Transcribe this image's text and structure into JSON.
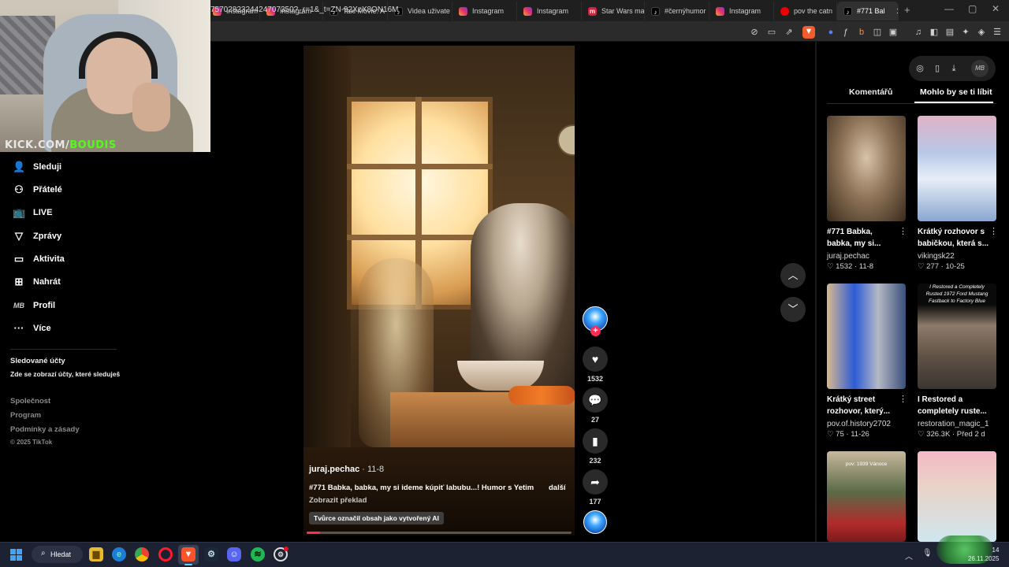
{
  "browser": {
    "tabs": [
      {
        "label": "Instagram",
        "favicon": "instagram"
      },
      {
        "label": "Instagram",
        "favicon": "instagram"
      },
      {
        "label": "Taxi Movie: A",
        "favicon": "tiktok"
      },
      {
        "label": "Videa uživate",
        "favicon": "tiktok"
      },
      {
        "label": "Instagram",
        "favicon": "instagram"
      },
      {
        "label": "Instagram",
        "favicon": "instagram"
      },
      {
        "label": "Star Wars ma",
        "favicon": "m"
      },
      {
        "label": "#černýhumor",
        "favicon": "tiktok"
      },
      {
        "label": "Instagram",
        "favicon": "instagram"
      },
      {
        "label": "pov the catn",
        "favicon": "youtube"
      },
      {
        "label": "#771 Bal",
        "favicon": "tiktok",
        "active": true
      }
    ],
    "new_tab": "+",
    "url": "7570282324424707350?_r=1&_t=ZN-92XzX8ON16M"
  },
  "stream": {
    "logo_prefix": "KICK.COM/",
    "logo_name": "BOUDIS"
  },
  "sidebar": {
    "items": [
      {
        "label": "Sleduji",
        "icon": "following-icon"
      },
      {
        "label": "Přátelé",
        "icon": "friends-icon"
      },
      {
        "label": "LIVE",
        "icon": "live-icon"
      },
      {
        "label": "Zprávy",
        "icon": "messages-icon"
      },
      {
        "label": "Aktivita",
        "icon": "activity-icon"
      },
      {
        "label": "Nahrát",
        "icon": "upload-icon"
      },
      {
        "label": "Profil",
        "icon": "profile-icon",
        "icon_text": "MB"
      },
      {
        "label": "Více",
        "icon": "more-icon"
      }
    ],
    "followed_title": "Sledované účty",
    "followed_sub": "Zde se zobrazí účty, které sleduješ",
    "footer": [
      "Společnost",
      "Program",
      "Podmínky a zásady"
    ],
    "copyright": "© 2025 TikTok"
  },
  "video": {
    "author": "juraj.pechac",
    "date": " · 11-8",
    "caption": "#771 Babka, babka, my si ideme kúpiť labubu...!  Humor s Yetim",
    "more": "další",
    "translate": "Zobrazit překlad",
    "ai_label": "Tvůrce označil obsah jako vytvořený AI",
    "progress": 0.05,
    "actions": {
      "likes": "1532",
      "comments": "27",
      "saves": "232",
      "shares": "177"
    }
  },
  "right_panel": {
    "tabs": [
      "Komentářů",
      "Mohlo by se ti líbit"
    ],
    "profile_initials": "MB",
    "cards": [
      {
        "title_1": "#771 Babka,",
        "title_2": "babka, my si...",
        "user": "juraj.pechac",
        "likes": "1532",
        "date": "11-8"
      },
      {
        "title_1": "Krátký rozhovor s",
        "title_2": "babičkou, která s...",
        "user": "vikingsk22",
        "likes": "277",
        "date": "10-25"
      },
      {
        "title_1": "Krátký street",
        "title_2": "rozhovor, který...",
        "user": "pov.of.history2702",
        "likes": "75",
        "date": "11-26"
      },
      {
        "title_1": "I Restored a",
        "title_2": "completely ruste...",
        "user": "restoration_magic_1",
        "likes": "326.3K",
        "date": "Před 2 d",
        "thumb_text": "I Restored a Completely Rusted 1972 Ford Mustang Fastback to Factory Blue"
      },
      {
        "thumb_text": "pov: 1939 Vánoce"
      },
      {}
    ]
  },
  "taskbar": {
    "search": "Hledat",
    "time": "14",
    "date": "26.11.2025"
  }
}
